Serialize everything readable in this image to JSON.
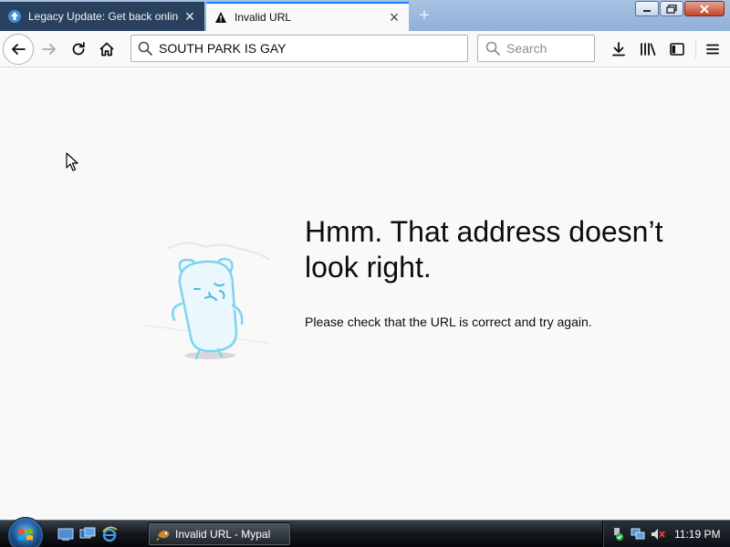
{
  "tabs": [
    {
      "title": "Legacy Update: Get back online",
      "icon": "legacy-update-favicon",
      "active": false
    },
    {
      "title": "Invalid URL",
      "icon": "warning-triangle-icon",
      "active": true
    }
  ],
  "navbar": {
    "url_value": "SOUTH PARK IS GAY",
    "search_placeholder": "Search"
  },
  "error_page": {
    "title": "Hmm. That address doesn’t look right.",
    "description": "Please check that the URL is correct and try again."
  },
  "taskbar": {
    "task_label": "Invalid URL - Mypal",
    "clock": "11:19 PM"
  },
  "colors": {
    "accent": "#0a84ff",
    "inactive_tab": "#29415f",
    "page_bg": "#f9f9fa",
    "illustration": "#7fd3f0"
  }
}
